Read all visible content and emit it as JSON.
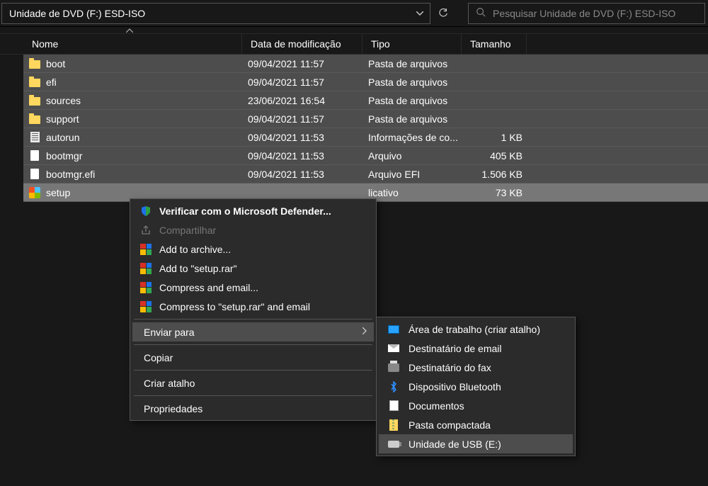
{
  "address": "Unidade de DVD (F:) ESD-ISO",
  "search_placeholder": "Pesquisar Unidade de DVD (F:) ESD-ISO",
  "columns": {
    "name": "Nome",
    "date": "Data de modificação",
    "type": "Tipo",
    "size": "Tamanho"
  },
  "rows": [
    {
      "icon": "folder",
      "name": "boot",
      "date": "09/04/2021 11:57",
      "type": "Pasta de arquivos",
      "size": ""
    },
    {
      "icon": "folder",
      "name": "efi",
      "date": "09/04/2021 11:57",
      "type": "Pasta de arquivos",
      "size": ""
    },
    {
      "icon": "folder",
      "name": "sources",
      "date": "23/06/2021 16:54",
      "type": "Pasta de arquivos",
      "size": ""
    },
    {
      "icon": "folder",
      "name": "support",
      "date": "09/04/2021 11:57",
      "type": "Pasta de arquivos",
      "size": ""
    },
    {
      "icon": "inf",
      "name": "autorun",
      "date": "09/04/2021 11:53",
      "type": "Informações de co...",
      "size": "1 KB"
    },
    {
      "icon": "file",
      "name": "bootmgr",
      "date": "09/04/2021 11:53",
      "type": "Arquivo",
      "size": "405 KB"
    },
    {
      "icon": "file",
      "name": "bootmgr.efi",
      "date": "09/04/2021 11:53",
      "type": "Arquivo EFI",
      "size": "1.506 KB"
    },
    {
      "icon": "app",
      "name": "setup",
      "date": "",
      "type": "",
      "size": "73 KB",
      "highlight": true,
      "typeFallback": "Aplicativo",
      "extraType": "licativo"
    }
  ],
  "last_row_type": "licativo",
  "context_menu": {
    "defender": "Verificar com o Microsoft Defender...",
    "share": "Compartilhar",
    "add_archive": "Add to archive...",
    "add_setup": "Add to \"setup.rar\"",
    "compress_email": "Compress and email...",
    "compress_setup_email": "Compress to \"setup.rar\" and email",
    "send_to": "Enviar para",
    "copy": "Copiar",
    "shortcut": "Criar atalho",
    "properties": "Propriedades"
  },
  "submenu": {
    "desktop": "Área de trabalho (criar atalho)",
    "mail": "Destinatário de email",
    "fax": "Destinatário do fax",
    "bluetooth": "Dispositivo Bluetooth",
    "documents": "Documentos",
    "compressed": "Pasta compactada",
    "usb": "Unidade de USB (E:)"
  }
}
